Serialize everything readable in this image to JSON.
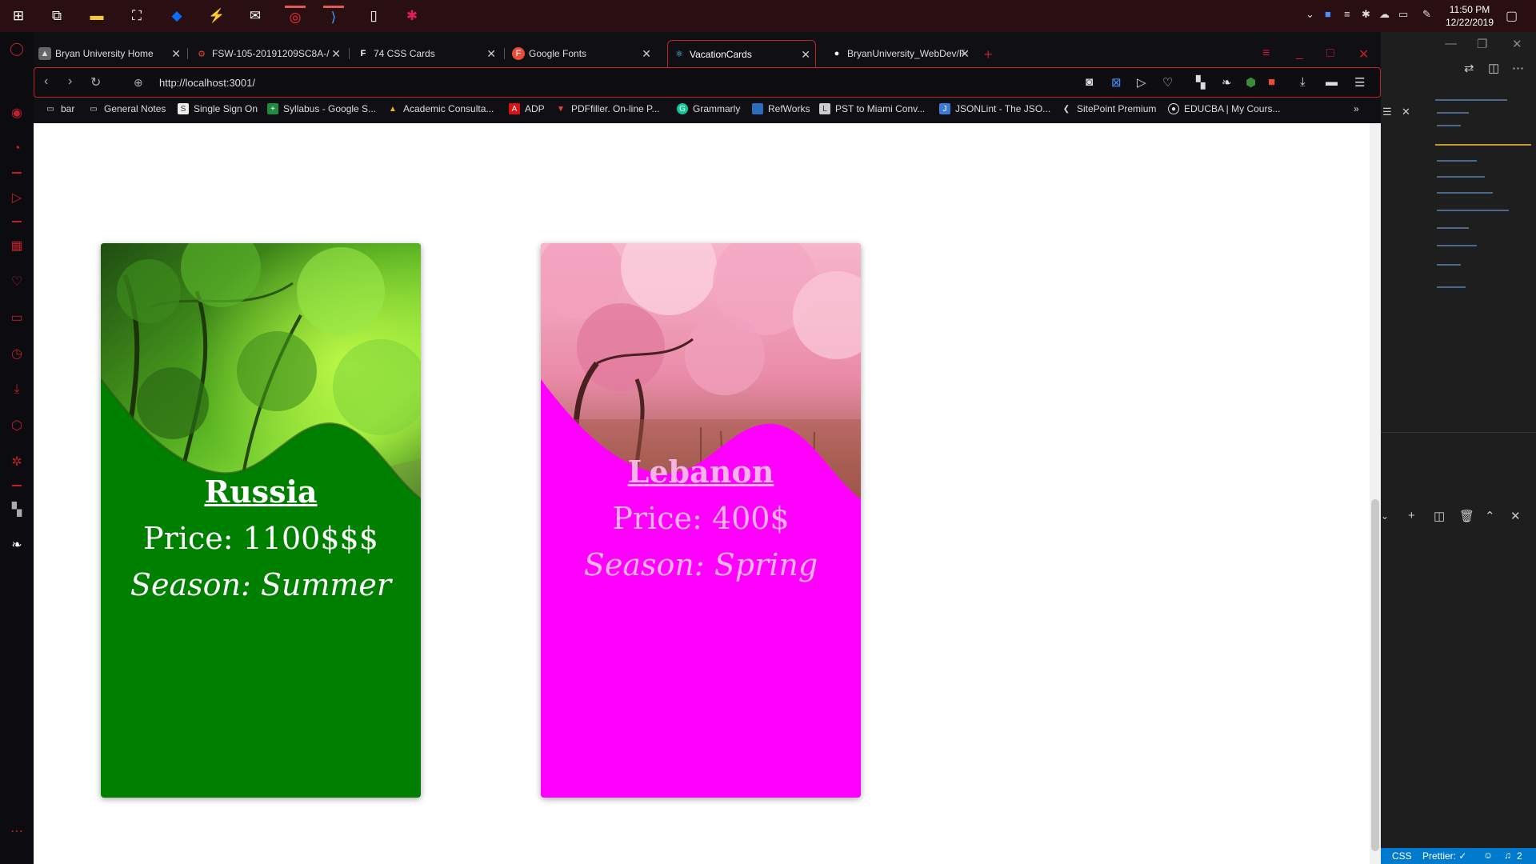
{
  "taskbar": {
    "time": "11:50 PM",
    "date": "12/22/2019"
  },
  "tabs": [
    {
      "label": "Bryan University Home",
      "favicon_color": "#666666"
    },
    {
      "label": "FSW-105-20191209SC8A-/",
      "favicon_color": "#e0442a"
    },
    {
      "label": "74 CSS Cards",
      "favicon_color": "#333333"
    },
    {
      "label": "Google Fonts",
      "favicon_color": "#e84a3c"
    },
    {
      "label": "VacationCards",
      "favicon_color": "#61dafb"
    },
    {
      "label": "BryanUniversity_WebDev/F",
      "favicon_color": "#ffffff"
    }
  ],
  "address": {
    "url": "http://localhost:3001/"
  },
  "bookmarks": [
    {
      "label": "bar"
    },
    {
      "label": "General Notes"
    },
    {
      "label": "Single Sign On"
    },
    {
      "label": "Syllabus - Google S..."
    },
    {
      "label": "Academic Consulta..."
    },
    {
      "label": "ADP"
    },
    {
      "label": "PDFfiller. On-line P..."
    },
    {
      "label": "Grammarly"
    },
    {
      "label": "RefWorks"
    },
    {
      "label": "PST to Miami Conv..."
    },
    {
      "label": "JSONLint - The JSO..."
    },
    {
      "label": "SitePoint Premium"
    },
    {
      "label": "EDUCBA | My Cours..."
    }
  ],
  "cards": [
    {
      "title": "Russia",
      "price": "Price: 1100$$$",
      "season": "Season: Summer",
      "bg_color": "#008000",
      "text_color": "#ffffff",
      "image": "green forest path"
    },
    {
      "title": "Lebanon",
      "price": "Price: 400$",
      "season": "Season: Spring",
      "bg_color": "#ff00ff",
      "text_color": "#f8b4e8",
      "image": "pink cherry blossoms"
    }
  ],
  "vscode": {
    "status_language": "CSS",
    "status_prettier": "Prettier: ✓",
    "status_notifications": "2"
  }
}
